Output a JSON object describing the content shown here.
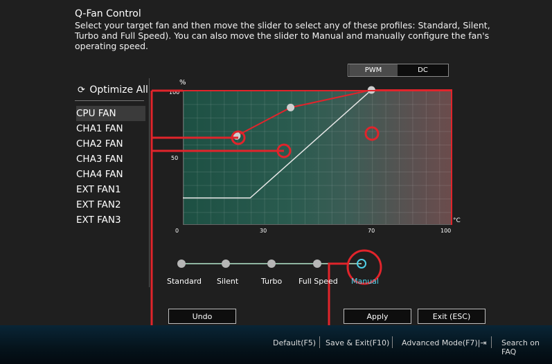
{
  "header": {
    "title": "Q-Fan Control",
    "description": "Select your target fan and then move the slider to select any of these profiles: Standard, Silent, Turbo and Full Speed). You can also move the slider to Manual and manually configure the fan's operating speed."
  },
  "mode_toggle": {
    "pwm": "PWM",
    "dc": "DC",
    "selected": "PWM"
  },
  "sidebar": {
    "optimize_label": "Optimize All",
    "fans": [
      "CPU FAN",
      "CHA1 FAN",
      "CHA2 FAN",
      "CHA3 FAN",
      "CHA4 FAN",
      "EXT FAN1",
      "EXT FAN2",
      "EXT FAN3"
    ],
    "selected_fan": "CPU FAN"
  },
  "chart_data": {
    "type": "line",
    "y_unit": "%",
    "x_unit": "°C",
    "y_ticks": [
      "100",
      "50"
    ],
    "x_ticks": [
      "0",
      "30",
      "70",
      "100"
    ],
    "xlim": [
      0,
      100
    ],
    "ylim": [
      0,
      100
    ],
    "series": [
      {
        "x": [
          0,
          25,
          70,
          100
        ],
        "y": [
          20,
          20,
          100,
          100
        ]
      },
      {
        "x": [
          20,
          40,
          70,
          100
        ],
        "y": [
          66,
          87,
          100,
          100
        ]
      }
    ]
  },
  "slider": {
    "labels": [
      "Standard",
      "Silent",
      "Turbo",
      "Full Speed",
      "Manual"
    ],
    "selected": "Manual"
  },
  "buttons": {
    "undo": "Undo",
    "apply": "Apply",
    "exit": "Exit (ESC)"
  },
  "bottom_bar": {
    "default": "Default(F5)",
    "save_exit": "Save & Exit(F10)",
    "advanced": "Advanced Mode(F7)|⇥",
    "search": "Search on FAQ"
  }
}
